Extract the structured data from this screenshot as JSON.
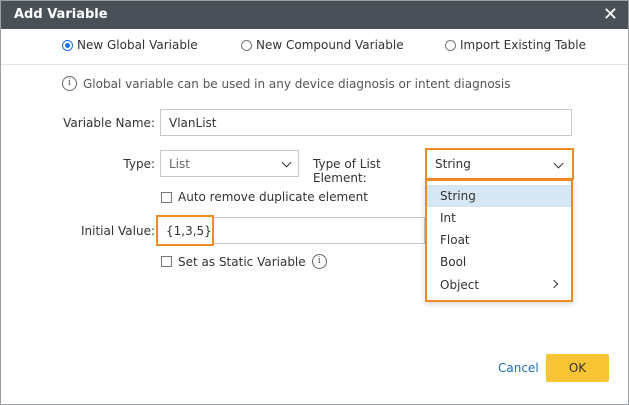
{
  "window": {
    "title": "Add Variable",
    "close_glyph": "✕"
  },
  "variable_kind": {
    "options": [
      {
        "label": "New Global Variable",
        "selected": true
      },
      {
        "label": "New Compound Variable",
        "selected": false
      },
      {
        "label": "Import Existing Table",
        "selected": false
      }
    ]
  },
  "info": {
    "icon_glyph": "i",
    "text": "Global variable can be used in any device diagnosis or intent diagnosis"
  },
  "form": {
    "name_label": "Variable Name:",
    "name_value": "VlanList",
    "type_label": "Type:",
    "type_value": "List",
    "list_elem_label": "Type of List Element:",
    "list_elem_value": "String",
    "auto_remove_label": "Auto remove duplicate element",
    "initial_label": "Initial Value:",
    "initial_value": "{1,3,5}",
    "static_label": "Set as Static Variable",
    "static_info_glyph": "i"
  },
  "dropdown": {
    "items": [
      {
        "label": "String",
        "selected": true
      },
      {
        "label": "Int",
        "selected": false
      },
      {
        "label": "Float",
        "selected": false
      },
      {
        "label": "Bool",
        "selected": false
      },
      {
        "label": "Object",
        "selected": false,
        "submenu": true
      }
    ]
  },
  "footer": {
    "cancel_label": "Cancel",
    "ok_label": "OK"
  },
  "colors": {
    "titlebar": "#4a5058",
    "highlight": "#f08a24",
    "ok_button": "#f9c434",
    "accent": "#1a73e8",
    "selected_item": "#d6e6f2"
  },
  "icons": [
    "close-icon",
    "info-icon",
    "chevron-down-icon",
    "chevron-right-icon"
  ]
}
